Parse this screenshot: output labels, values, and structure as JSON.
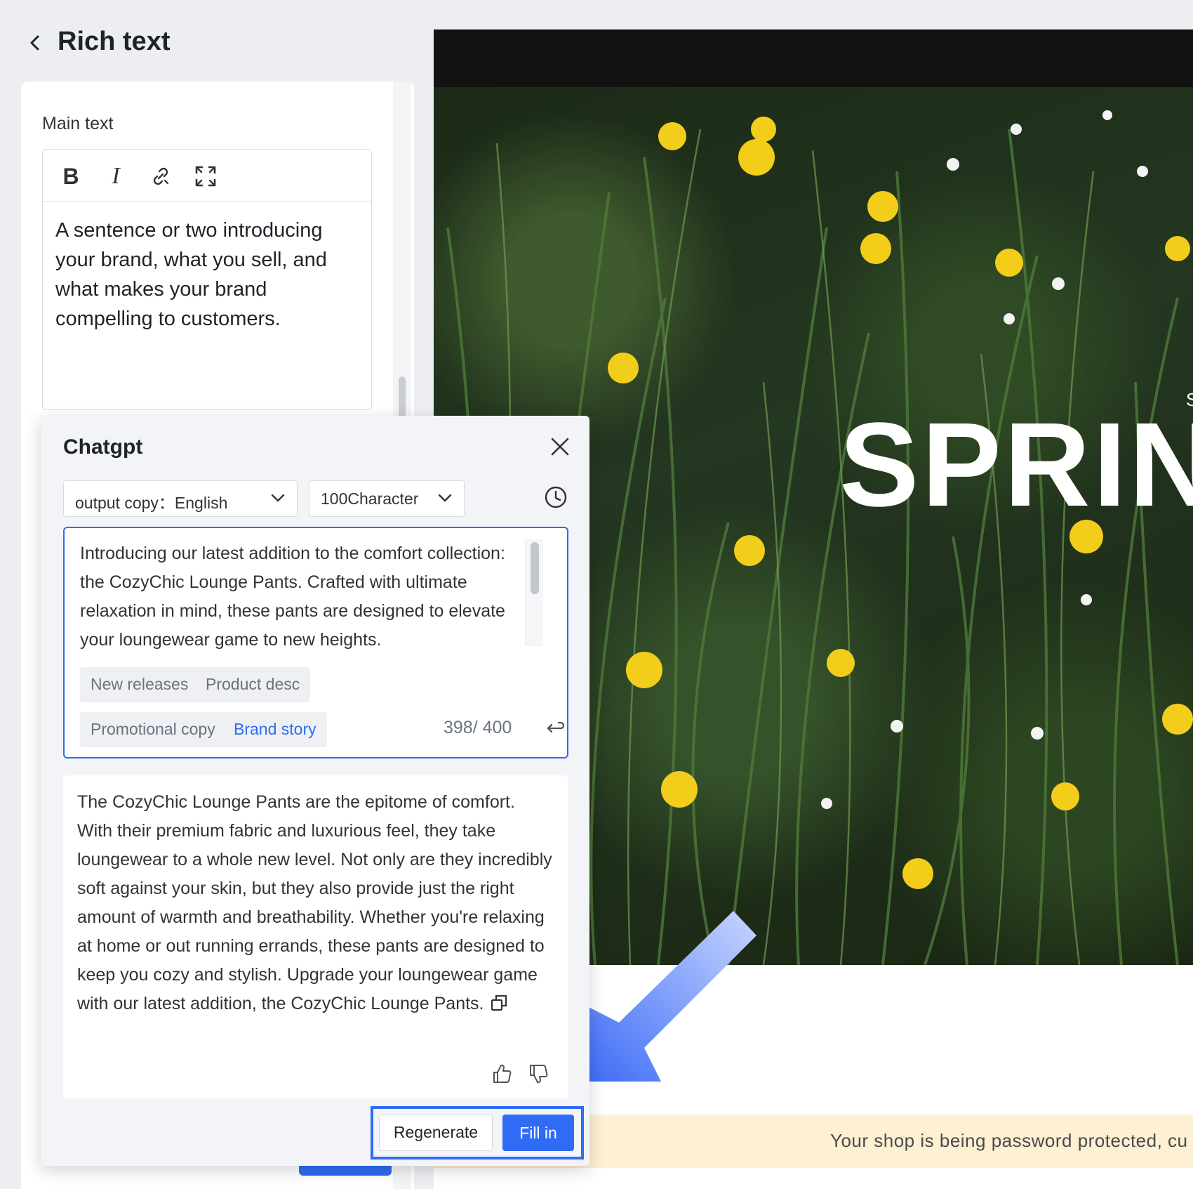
{
  "header": {
    "title": "Rich text"
  },
  "editor": {
    "label": "Main text",
    "toolbar": {
      "bold": "B",
      "italic": "I"
    },
    "content": "A sentence or two introducing your brand, what you sell, and what makes your brand compelling to customers."
  },
  "preview": {
    "hero_small_text": "S",
    "hero_title": "SPRIN",
    "banner_text": "Your shop is being password protected, cu"
  },
  "chatgpt": {
    "title": "Chatgpt",
    "language_select": "output copy：English",
    "length_select": "100Character",
    "prompt_text": "Introducing our latest addition to the comfort collection: the CozyChic Lounge Pants. Crafted with ultimate relaxation in mind, these pants are designed to elevate your loungewear game to new heights.",
    "chips": [
      "New releases",
      "Product desc",
      "Promotional copy",
      "Brand story"
    ],
    "active_chip": "Brand story",
    "counter": "398/ 400",
    "result_text": "The CozyChic Lounge Pants are the epitome of comfort. With their premium fabric and luxurious feel, they take loungewear to a whole new level. Not only are they incredibly soft against your skin, but they also provide just the right amount of warmth and breathability. Whether you're relaxing at home or out running errands, these pants are designed to keep you cozy and stylish. Upgrade your loungewear game with our latest addition, the CozyChic Lounge Pants.",
    "regenerate_label": "Regenerate",
    "fill_in_label": "Fill in"
  },
  "colors": {
    "accent": "#2f6bf5",
    "banner": "#fdf0d3",
    "topbar": "#121212"
  },
  "icons": [
    "chevron-left-icon",
    "bold-icon",
    "italic-icon",
    "link-icon",
    "expand-icon",
    "close-icon",
    "chevron-down-icon",
    "history-icon",
    "enter-icon",
    "copy-icon",
    "thumbs-up-icon",
    "thumbs-down-icon",
    "arrow-icon"
  ]
}
